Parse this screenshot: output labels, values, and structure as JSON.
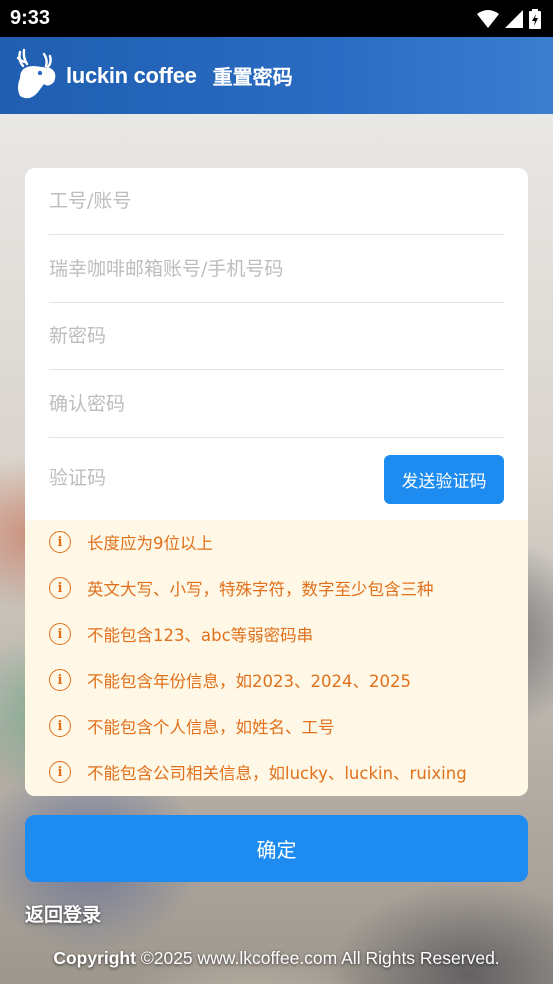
{
  "status_bar": {
    "time": "9:33"
  },
  "header": {
    "brand": "luckin coffee",
    "title": "重置密码"
  },
  "form": {
    "employee_id_placeholder": "工号/账号",
    "email_phone_placeholder": "瑞幸咖啡邮箱账号/手机号码",
    "new_password_placeholder": "新密码",
    "confirm_password_placeholder": "确认密码",
    "verification_code_placeholder": "验证码",
    "send_code_label": "发送验证码"
  },
  "password_rules": [
    "长度应为9位以上",
    "英文大写、小写，特殊字符，数字至少包含三种",
    "不能包含123、abc等弱密码串",
    "不能包含年份信息，如2023、2024、2025",
    "不能包含个人信息，如姓名、工号",
    "不能包含公司相关信息，如lucky、luckin、ruixing"
  ],
  "actions": {
    "confirm_label": "确定",
    "back_label": "返回登录"
  },
  "footer": {
    "copyright_bold": "Copyright",
    "copyright_rest": "©2025 www.lkcoffee.com All Rights Reserved."
  },
  "colors": {
    "header_blue": "#2a6cc3",
    "button_blue": "#1e8bf0",
    "rule_orange": "#e0701c",
    "rules_bg": "#fff8e6"
  },
  "icons": {
    "info": "info-circle-icon",
    "logo": "luckin-deer-logo"
  }
}
